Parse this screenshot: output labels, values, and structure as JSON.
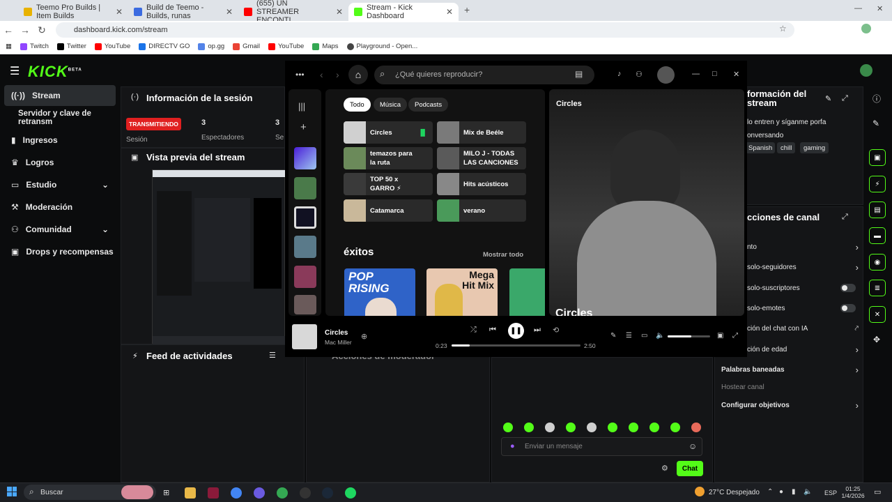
{
  "browser": {
    "tabs": [
      {
        "label": "Teemo Pro Builds | Item Builds",
        "color": "#e8b200"
      },
      {
        "label": "Build de Teemo - Builds, runas",
        "color": "#3b6be0"
      },
      {
        "label": "(655) UN STREAMER ENCONTI",
        "color": "#ff0000"
      },
      {
        "label": "Stream - Kick Dashboard",
        "color": "#53fc18"
      }
    ],
    "url": "dashboard.kick.com/stream",
    "bookmarks": [
      "Twitch",
      "Twitter",
      "YouTube",
      "DIRECTV GO",
      "op.gg",
      "Gmail",
      "YouTube",
      "Maps",
      "Playground - Open..."
    ]
  },
  "kick": {
    "logo": "KICK",
    "logo_tag": "BETA",
    "sidebar": [
      {
        "label": "Stream",
        "icon": "broadcast-icon"
      },
      {
        "label": "Servidor y clave de retransm",
        "icon": ""
      },
      {
        "label": "Ingresos",
        "icon": "chart-icon"
      },
      {
        "label": "Logros",
        "icon": "trophy-icon"
      },
      {
        "label": "Estudio",
        "icon": "studio-icon"
      },
      {
        "label": "Moderación",
        "icon": "hammer-icon"
      },
      {
        "label": "Comunidad",
        "icon": "people-icon"
      },
      {
        "label": "Drops y recompensas",
        "icon": "gift-icon"
      }
    ],
    "session": {
      "title": "Información de la sesión",
      "status": "TRANSMITIENDO",
      "label_session": "Sesión",
      "viewers_value": "3",
      "viewers_label": "Espectadores",
      "second_value": "3",
      "second_label": "Se"
    },
    "preview_title": "Vista previa del stream",
    "feed_title": "Feed de actividades",
    "modactions_title": "Acciones de moderador",
    "stream_info": {
      "title": "formación del stream",
      "text": "lo entren y síganme porfa",
      "category": "onversando",
      "tags": [
        "Spanish",
        "chill",
        "gaming"
      ]
    },
    "channel_actions": {
      "title": "cciones de canal",
      "rows": [
        {
          "label": "nto",
          "control": "chevron"
        },
        {
          "label": "solo-seguidores",
          "control": "chevron"
        },
        {
          "label": "solo-suscriptores",
          "control": "toggle"
        },
        {
          "label": "solo-emotes",
          "control": "toggle"
        },
        {
          "label": "ción del chat con IA",
          "control": "external"
        },
        {
          "label": "ción de edad",
          "control": "chevron"
        },
        {
          "label": "Palabras baneadas",
          "control": "chevron"
        },
        {
          "label": "Hostear canal",
          "control": "none"
        },
        {
          "label": "Configurar objetivos",
          "control": "chevron"
        }
      ]
    },
    "chat": {
      "placeholder": "Enviar un mensaje",
      "send": "Chat"
    }
  },
  "spotify": {
    "search_placeholder": "¿Qué quieres reproducir?",
    "filters": [
      "Todo",
      "Música",
      "Podcasts"
    ],
    "grid": [
      {
        "label": "Circles",
        "color": "#d0d0d0"
      },
      {
        "label": "Mix de Beéle",
        "color": "#7a7a7a"
      },
      {
        "label": "temazos para la ruta",
        "color": "#6b8a5a"
      },
      {
        "label": "MILO J - TODAS LAS CANCIONES",
        "color": "#5a5a5a"
      },
      {
        "label": "TOP 50 x GARRO ⚡",
        "color": "#3a3a3a"
      },
      {
        "label": "Hits acústicos",
        "color": "#888"
      },
      {
        "label": "Catamarca",
        "color": "#c9b89a"
      },
      {
        "label": "verano",
        "color": "#4a9a5a"
      }
    ],
    "section_title": "éxitos",
    "show_all": "Mostrar todo",
    "cards": [
      {
        "label": "POP RISING",
        "color": "#2f63c8"
      },
      {
        "label": "Mega Hit Mix",
        "color": "#e8c8b0"
      },
      {
        "label": "",
        "color": "#3aa86a"
      }
    ],
    "now_playing_header": "Circles",
    "now_playing_caption": "Circles",
    "track": {
      "title": "Circles",
      "artist": "Mac Miller",
      "elapsed": "0:23",
      "duration": "2:50",
      "progress": 0.14,
      "volume": 0.55
    }
  },
  "taskbar": {
    "search": "Buscar",
    "weather": "27°C  Despejado",
    "lang": "ESP",
    "time": "01:25",
    "date": "1/4/2026"
  }
}
